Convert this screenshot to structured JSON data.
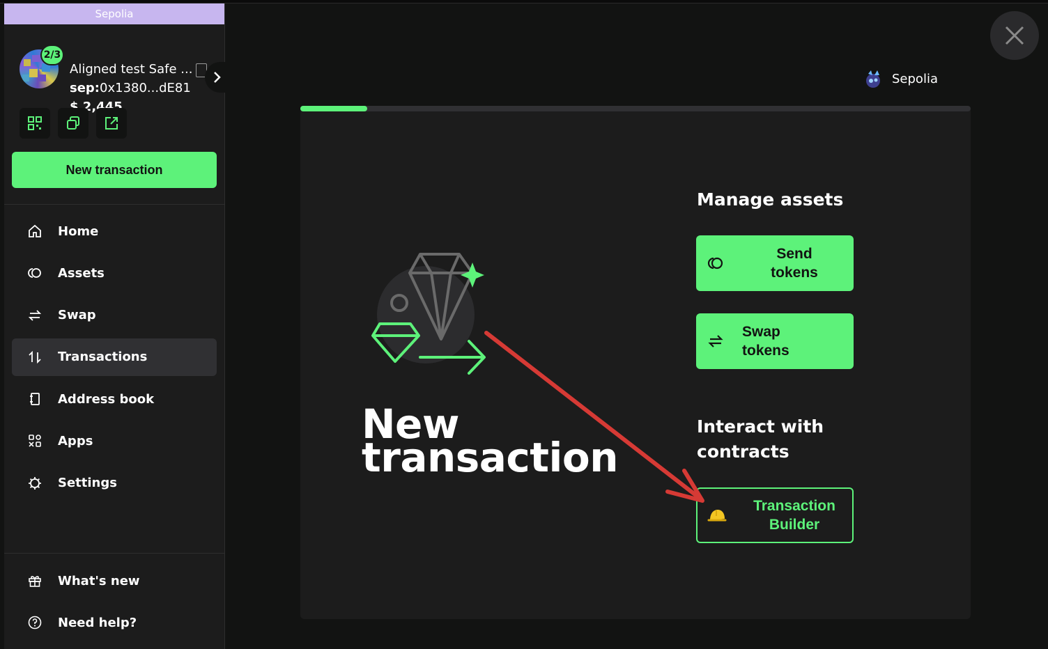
{
  "sidebar": {
    "network_banner": "Sepolia",
    "safe": {
      "threshold": "2/3",
      "name": "Aligned test Safe ...",
      "address_prefix": "sep:",
      "address": "0x1380...dE81",
      "balance": "$ 2,445"
    },
    "new_transaction_label": "New transaction",
    "nav": [
      {
        "label": "Home",
        "icon": "home-icon"
      },
      {
        "label": "Assets",
        "icon": "assets-icon"
      },
      {
        "label": "Swap",
        "icon": "swap-icon"
      },
      {
        "label": "Transactions",
        "icon": "transactions-icon",
        "active": true
      },
      {
        "label": "Address book",
        "icon": "address-book-icon"
      },
      {
        "label": "Apps",
        "icon": "apps-icon"
      },
      {
        "label": "Settings",
        "icon": "settings-icon"
      }
    ],
    "footer": [
      {
        "label": "What's new",
        "icon": "gift-icon"
      },
      {
        "label": "Need help?",
        "icon": "help-icon"
      }
    ]
  },
  "header": {
    "network": "Sepolia"
  },
  "modal": {
    "progress": 0.1,
    "title_line1": "New",
    "title_line2": "transaction",
    "manage_assets_title": "Manage assets",
    "send_tokens_line1": "Send",
    "send_tokens_line2": "tokens",
    "swap_tokens_line1": "Swap",
    "swap_tokens_line2": "tokens",
    "interact_title_line1": "Interact with",
    "interact_title_line2": "contracts",
    "tx_builder_line1": "Transaction",
    "tx_builder_line2": "Builder"
  },
  "colors": {
    "accent": "#5df27a",
    "background": "#121312",
    "panel": "#1c1c1c",
    "annotation_arrow": "#d63a35",
    "network_banner": "#c7b6ef"
  }
}
